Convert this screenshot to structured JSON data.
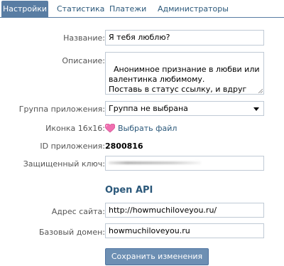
{
  "tabs": [
    {
      "label": "Настройки",
      "active": true
    },
    {
      "label": "Статистика",
      "active": false
    },
    {
      "label": "Платежи",
      "active": false
    },
    {
      "label": "Администраторы",
      "active": false
    }
  ],
  "form": {
    "name_label": "Название:",
    "name_value": "Я тебя люблю?",
    "description_label": "Описание:",
    "description_value": "Анонимное признание в любви или валентинка любимому.\nПоставь в статус ссылку, и вдруг тот, кого ты любишь зайдет к тебе!",
    "group_label": "Группа приложения:",
    "group_value": "Группа не выбрана",
    "icon_label": "Иконка 16x16:",
    "icon_name": "heart-icon",
    "icon_link": "Выбрать файл",
    "app_id_label": "ID приложения:",
    "app_id_value": "2800816",
    "secret_label": "Защищенный ключ:"
  },
  "open_api": {
    "title": "Open API",
    "site_label": "Адрес сайта:",
    "site_value": "http://howmuchiloveyou.ru/",
    "domain_label": "Базовый домен:",
    "domain_value": "howmuchiloveyou.ru"
  },
  "save_label": "Сохранить изменения",
  "colors": {
    "accent": "#597da3",
    "link": "#2b587a",
    "button": "#6d8fb3",
    "heart": "#f06fb0"
  }
}
